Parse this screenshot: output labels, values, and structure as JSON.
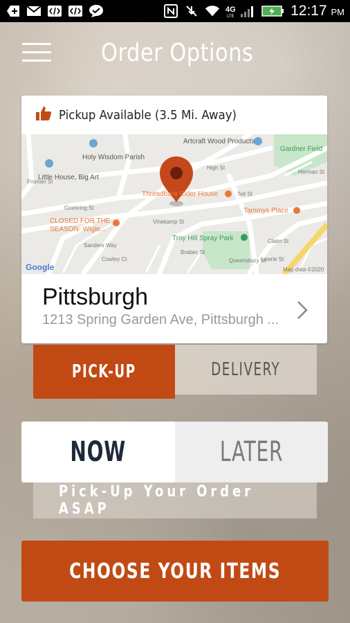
{
  "status_bar": {
    "time": "12:17",
    "ampm": "PM",
    "network": "4G LTE",
    "icons": [
      "add-icon",
      "gmail-icon",
      "code-icon",
      "code-icon",
      "message-icon",
      "nfc-icon",
      "mute-icon",
      "wifi-icon",
      "signal-icon",
      "battery-icon"
    ]
  },
  "header": {
    "title": "Order Options",
    "menu_icon": "hamburger-menu-icon"
  },
  "location_card": {
    "pickup_status": "Pickup Available (3.5 Mi. Away)",
    "status_icon": "thumbs-up-icon",
    "map": {
      "labels": {
        "artcraft": "Artcraft Wood Products",
        "gardner": "Gardner Field",
        "holy_wisdom": "Holy Wisdom Parish",
        "little_house": "Little House, Big Art",
        "threadbare": "Threadbare Cider House",
        "tammys": "Tammys Place",
        "closed": "CLOSED FOR THE",
        "closed2": "SEASON- Wigle...",
        "troy_hill": "Troy Hill Spray Park",
        "google": "Google",
        "map_data": "Map data ©2020",
        "high_st": "High St",
        "tell_st": "Tell St",
        "vinekamp_st": "Vinekamp St",
        "brabec_st": "Brabec St",
        "froman_st": "Froman St",
        "claim_st": "Claim St",
        "goehring_st": "Goehring St",
        "sanders_way": "Sanders Way",
        "herman_st": "Herman St",
        "cowley_ct": "Cowley Ct",
        "queensbury_st": "Queensbury St",
        "lowrie_st": "Lowrie St"
      }
    },
    "name": "Pittsburgh",
    "address": "1213 Spring Garden Ave, Pittsburgh ..."
  },
  "order_type": {
    "pickup_label": "PICK-UP",
    "delivery_label": "DELIVERY",
    "selected": "PICK-UP"
  },
  "order_time": {
    "now_label": "NOW",
    "later_label": "LATER",
    "selected": "NOW",
    "banner": "Pick-Up Your Order ASAP"
  },
  "cta": {
    "label": "CHOOSE YOUR ITEMS"
  },
  "colors": {
    "accent": "#c14a14",
    "pin": "#c4481c",
    "now_text": "#1e2a3a"
  }
}
